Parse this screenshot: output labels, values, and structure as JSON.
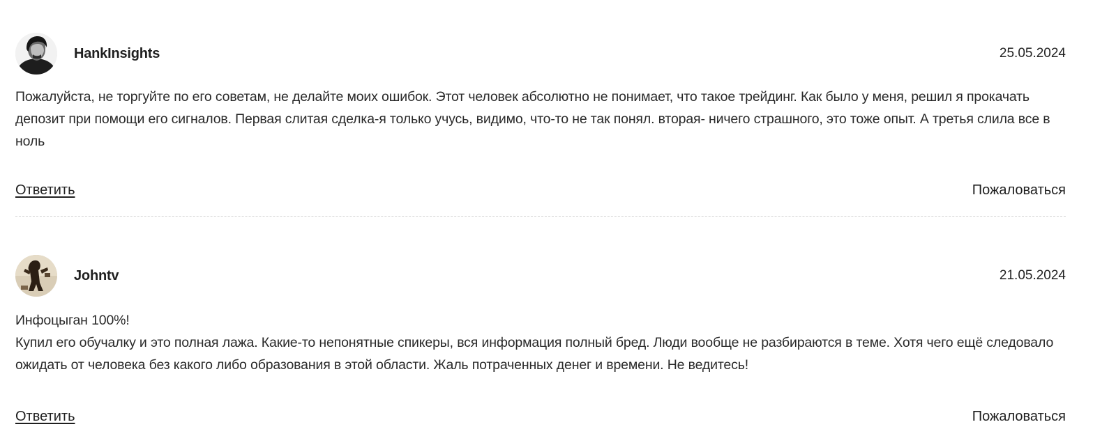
{
  "comments": [
    {
      "author": "HankInsights",
      "date": "25.05.2024",
      "avatar": "avatar-bw-portrait",
      "paragraphs": [
        "Пожалуйста, не торгуйте по его советам, не делайте моих ошибок. Этот человек абсолютно не понимает, что такое трейдинг. Как было у меня, решил я прокачать депозит при помощи его сигналов. Первая слитая сделка-я только учусь, видимо, что-то не так понял. вторая- ничего страшного, это тоже опыт. А третья слила все в ноль"
      ],
      "reply_label": "Ответить",
      "report_label": "Пожаловаться"
    },
    {
      "author": "Johntv",
      "date": "21.05.2024",
      "avatar": "avatar-sepia-photo",
      "paragraphs": [
        "Инфоцыган 100%!",
        "Купил его обучалку и это полная лажа. Какие-то непонятные спикеры, вся информация полный бред. Люди вообще не разбираются в теме. Хотя чего ещё следовало ожидать от человека без какого либо образования в этой области. Жаль потраченных денег и времени. Не ведитесь!"
      ],
      "reply_label": "Ответить",
      "report_label": "Пожаловаться"
    }
  ]
}
